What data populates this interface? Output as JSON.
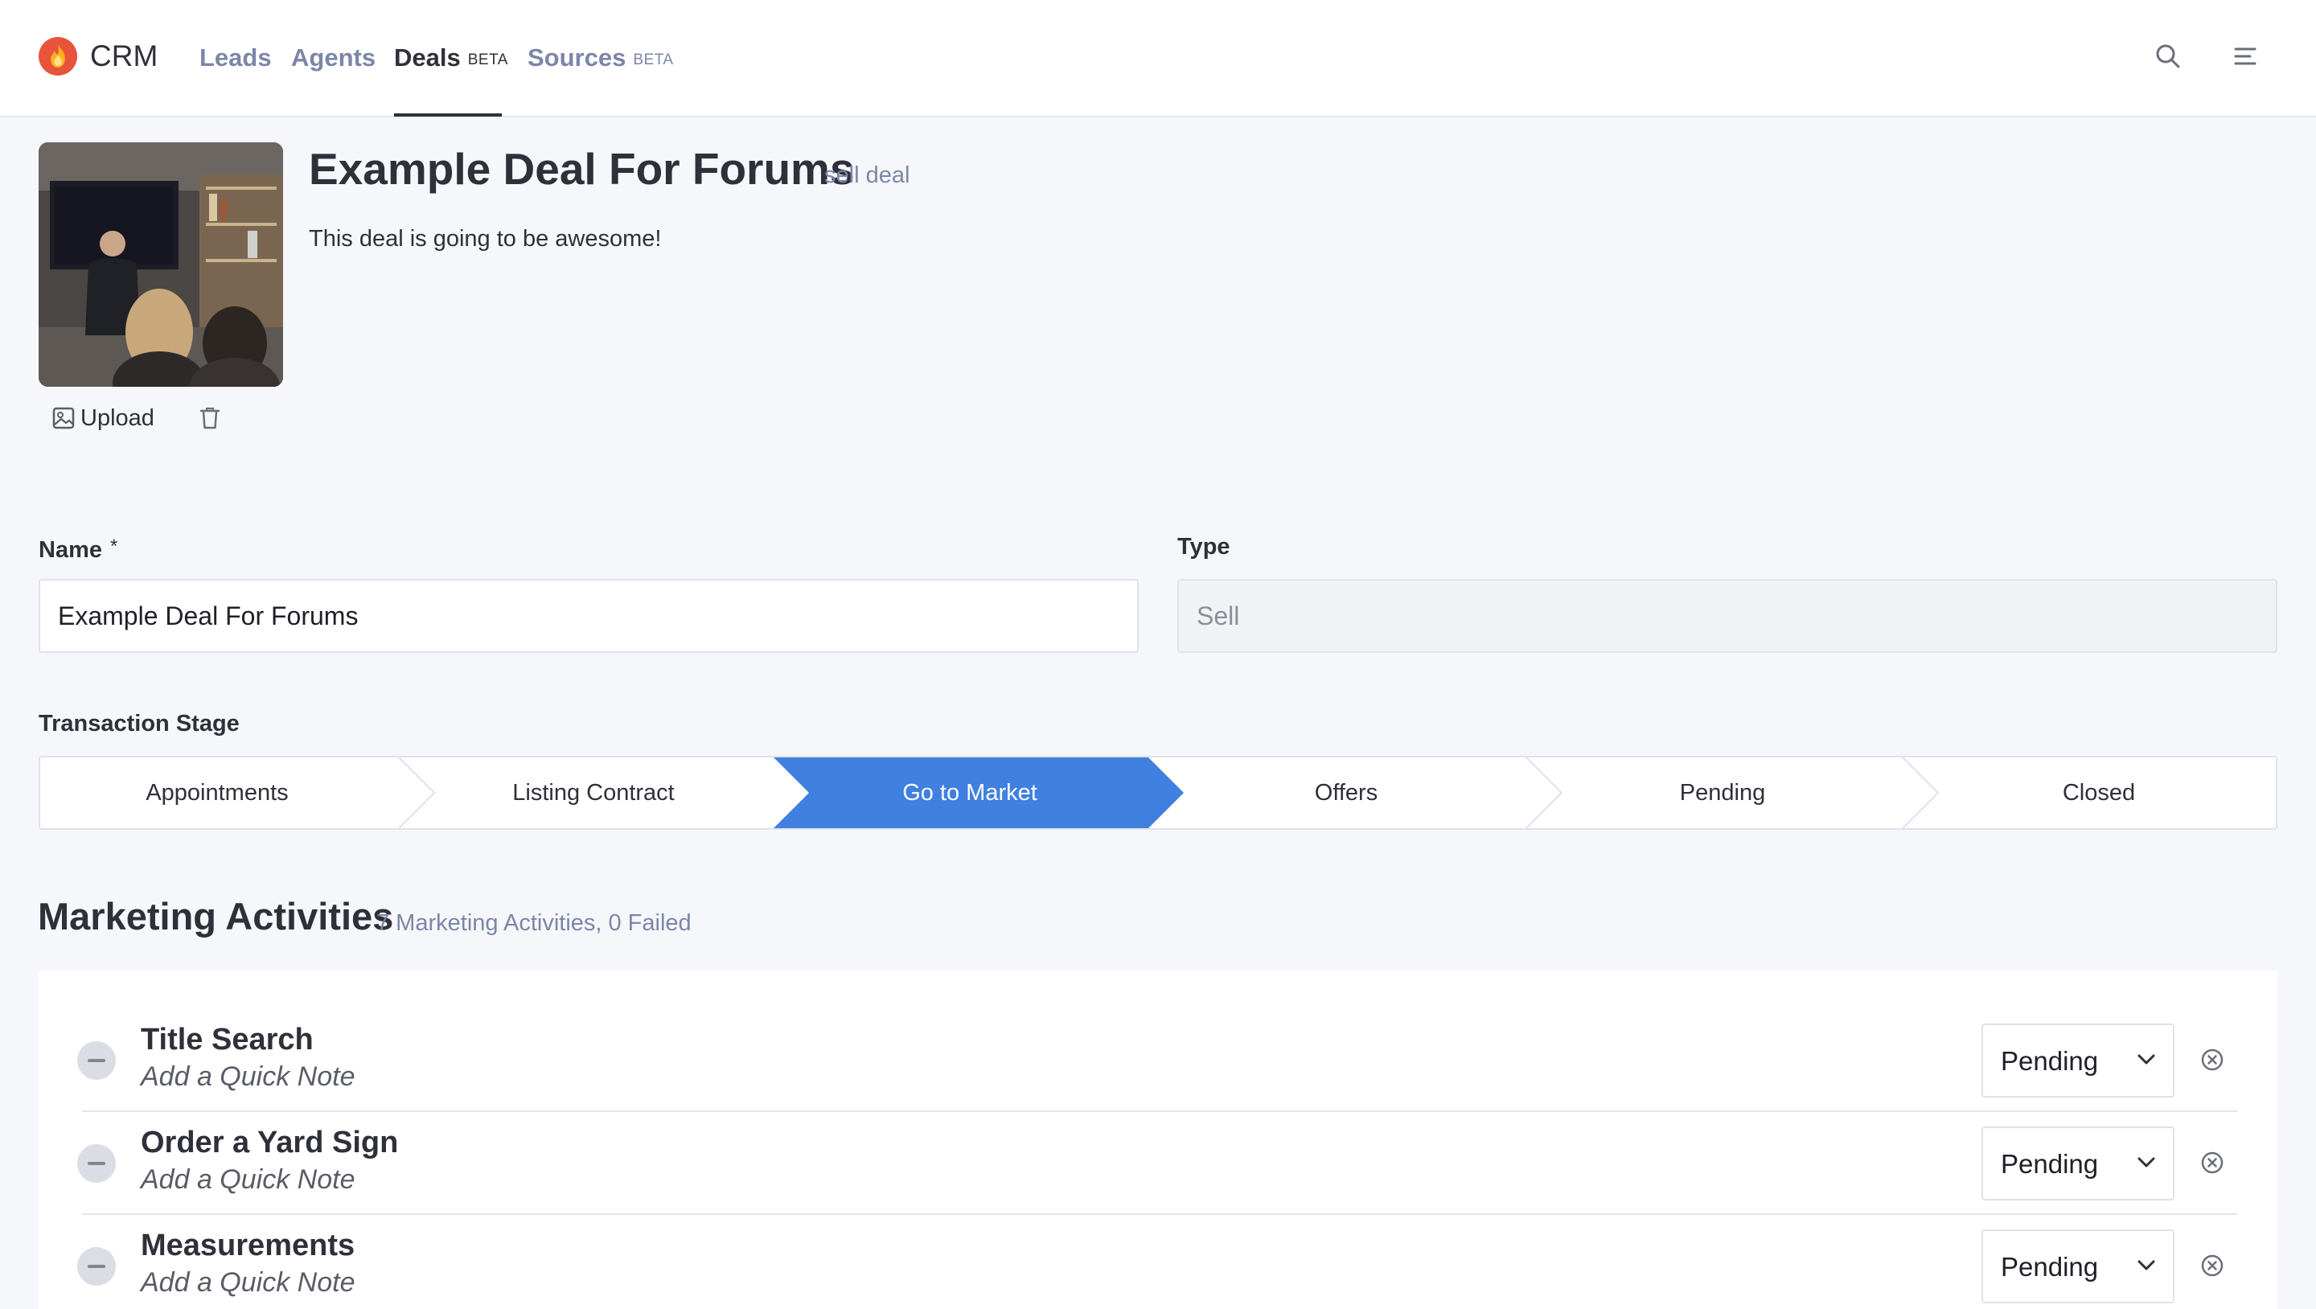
{
  "header": {
    "app_name": "CRM",
    "nav": [
      {
        "label": "Leads",
        "badge": ""
      },
      {
        "label": "Agents",
        "badge": ""
      },
      {
        "label": "Deals",
        "badge": "BETA"
      },
      {
        "label": "Sources",
        "badge": "BETA"
      }
    ],
    "active_nav": "Deals"
  },
  "deal": {
    "title": "Example Deal For Forums",
    "subtitle": "sell deal",
    "description": "This deal is going to be awesome!",
    "upload_label": "Upload"
  },
  "form": {
    "name_label": "Name",
    "name_required": "*",
    "name_value": "Example Deal For Forums",
    "type_label": "Type",
    "type_value": "Sell",
    "stage_label": "Transaction Stage"
  },
  "stages": [
    "Appointments",
    "Listing Contract",
    "Go to Market",
    "Offers",
    "Pending",
    "Closed"
  ],
  "active_stage": "Go to Market",
  "marketing": {
    "title": "Marketing Activities",
    "meta": "7 Marketing Activities, 0 Failed",
    "activities": [
      {
        "name": "Title Search",
        "note": "Add a Quick Note",
        "status": "Pending"
      },
      {
        "name": "Order a Yard Sign",
        "note": "Add a Quick Note",
        "status": "Pending"
      },
      {
        "name": "Measurements",
        "note": "Add a Quick Note",
        "status": "Pending"
      }
    ]
  },
  "colors": {
    "accent": "#3f80e0",
    "logo": "#e8533b",
    "muted_text": "#7c86a8",
    "page_bg": "#f6f7fa"
  },
  "icons": [
    "flame-logo-icon",
    "search-icon",
    "menu-icon",
    "image-icon",
    "trash-icon",
    "minus-icon",
    "chevron-down-icon",
    "close-circle-icon"
  ]
}
